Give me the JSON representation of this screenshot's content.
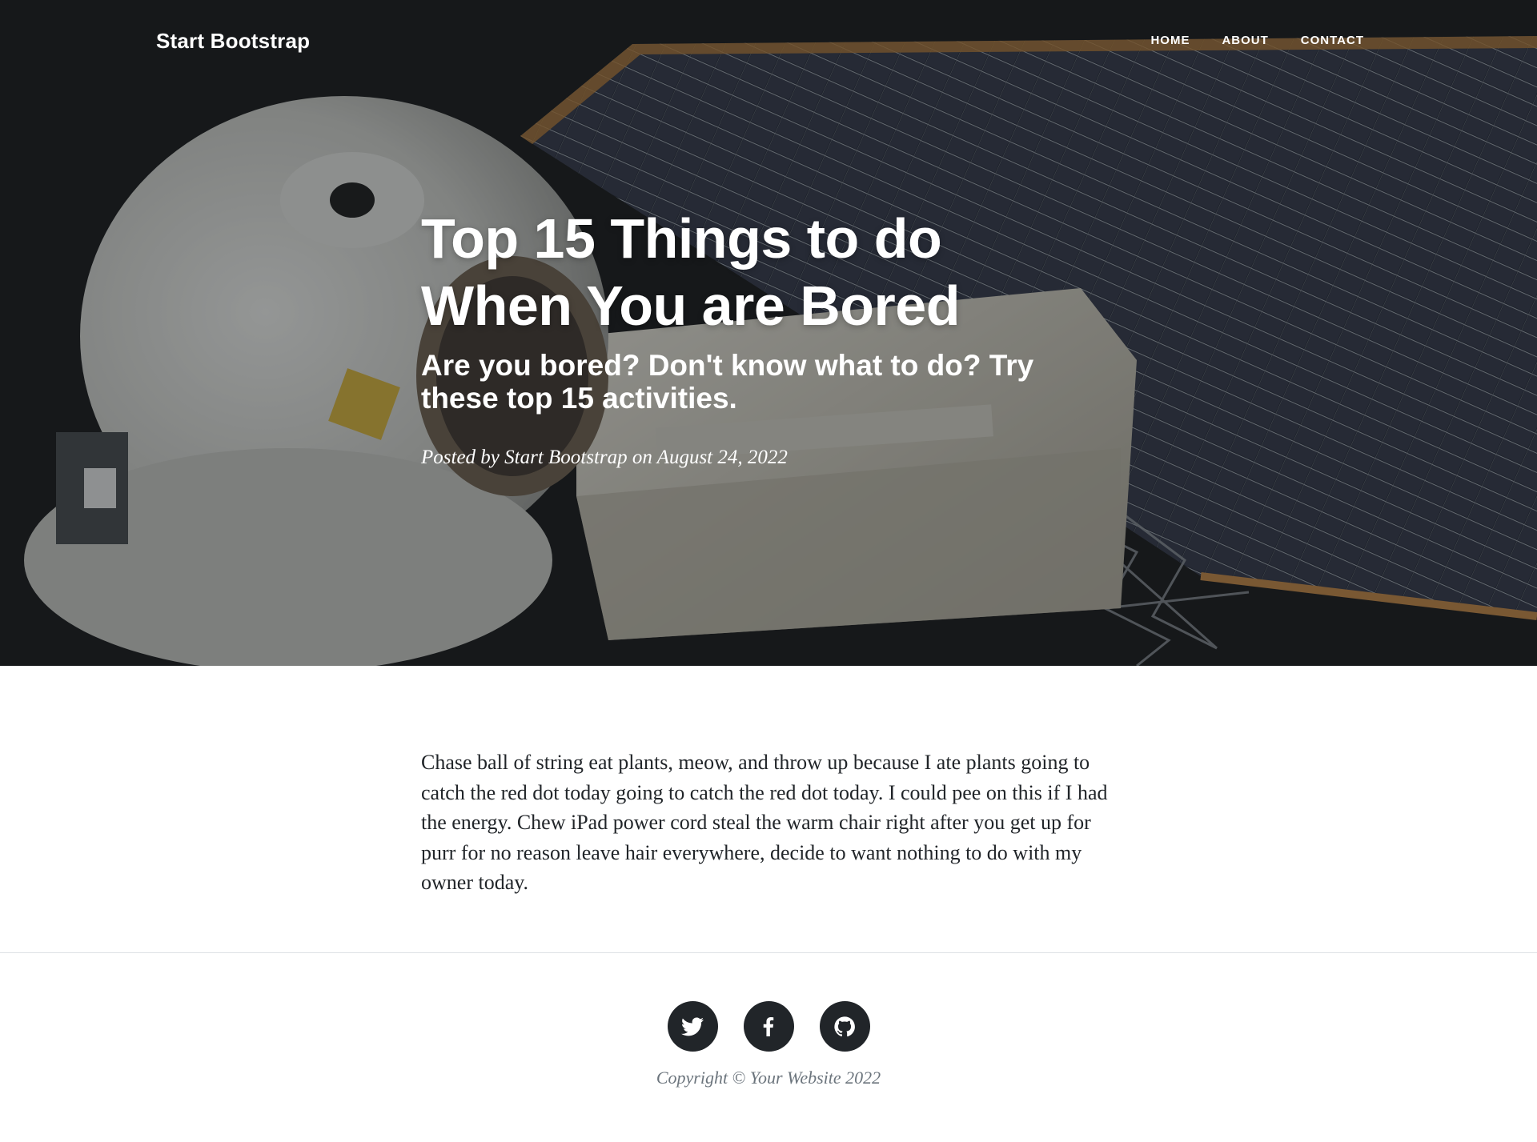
{
  "navbar": {
    "brand": "Start Bootstrap",
    "links": [
      "Home",
      "About",
      "Contact"
    ]
  },
  "hero": {
    "title_line1": "Top 15 Things to do",
    "title_line2": "When You are Bored",
    "subtitle": "Are you bored? Don't know what to do? Try these top 15 activities.",
    "meta": "Posted by Start Bootstrap on August 24, 2022",
    "background_image": "astronaut-space-station-photo"
  },
  "article": {
    "paragraph": "Chase ball of string eat plants, meow, and throw up because I ate plants going to catch the red dot today going to catch the red dot today. I could pee on this if I had the energy. Chew iPad power cord steal the warm chair right after you get up for purr for no reason leave hair everywhere, decide to want nothing to do with my owner today."
  },
  "footer": {
    "social": [
      "twitter-icon",
      "facebook-icon",
      "github-icon"
    ],
    "copyright": "Copyright © Your Website 2022"
  },
  "colors": {
    "dark": "#212529",
    "muted": "#6c757d",
    "white": "#ffffff"
  }
}
